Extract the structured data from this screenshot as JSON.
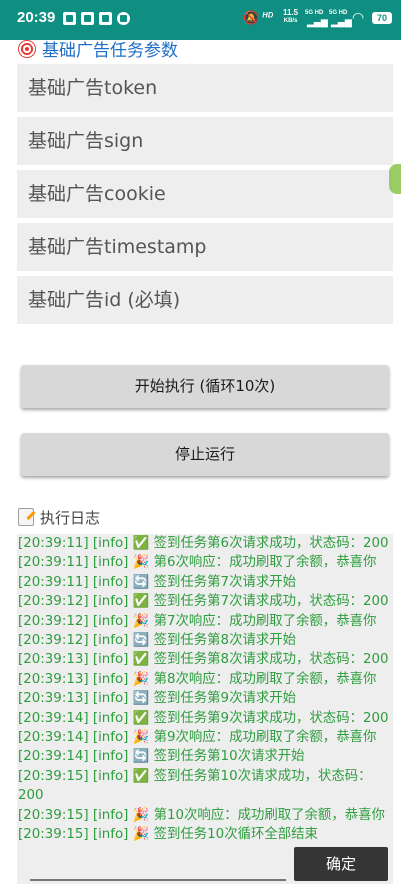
{
  "status_bar": {
    "time": "20:39",
    "net_speed_value": "11.5",
    "net_speed_unit": "KB/s",
    "signal_1": "5G HD",
    "signal_2": "5G HD",
    "battery": "70",
    "background_color": "#0e8f82"
  },
  "section": {
    "title": "基础广告任务参数",
    "icon": "target-icon"
  },
  "inputs": [
    {
      "placeholder": "基础广告token"
    },
    {
      "placeholder": "基础广告sign"
    },
    {
      "placeholder": "基础广告cookie"
    },
    {
      "placeholder": "基础广告timestamp"
    },
    {
      "placeholder": "基础广告id (必填)"
    }
  ],
  "buttons": {
    "start_label": "开始执行 (循环10次)",
    "stop_label": "停止运行"
  },
  "log": {
    "title": "执行日志",
    "icon": "memo-icon",
    "lines": [
      "[20:39:11] [info] ✅ 签到任务第6次请求成功，状态码：200",
      "[20:39:11] [info] 🎉 第6次响应：成功刷取了余额，恭喜你",
      "[20:39:11] [info] 🔄 签到任务第7次请求开始",
      "[20:39:12] [info] ✅ 签到任务第7次请求成功，状态码：200",
      "[20:39:12] [info] 🎉 第7次响应：成功刷取了余额，恭喜你",
      "[20:39:12] [info] 🔄 签到任务第8次请求开始",
      "[20:39:13] [info] ✅ 签到任务第8次请求成功，状态码：200",
      "[20:39:13] [info] 🎉 第8次响应：成功刷取了余额，恭喜你",
      "[20:39:13] [info] 🔄 签到任务第9次请求开始",
      "[20:39:14] [info] ✅ 签到任务第9次请求成功，状态码：200",
      "[20:39:14] [info] 🎉 第9次响应：成功刷取了余额，恭喜你",
      "[20:39:14] [info] 🔄 签到任务第10次请求开始",
      "[20:39:15] [info] ✅ 签到任务第10次请求成功，状态码：200",
      "[20:39:15] [info] 🎉 第10次响应：成功刷取了余额，恭喜你",
      "[20:39:15] [info] 🎉 签到任务10次循环全部结束"
    ],
    "text_color": "#2e9d3e"
  },
  "dialog": {
    "confirm_label": "确定"
  }
}
